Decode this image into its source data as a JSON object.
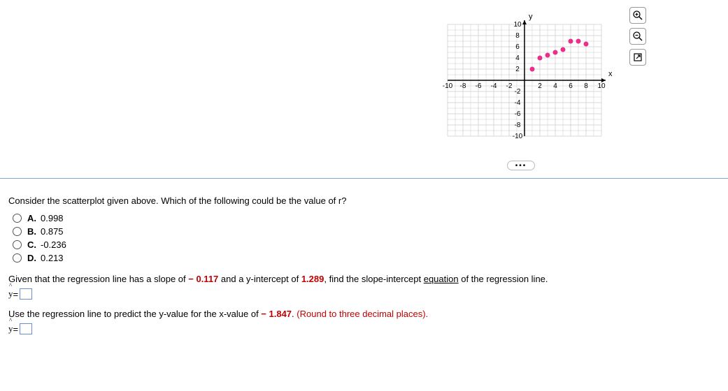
{
  "chart_data": {
    "type": "scatter",
    "x": [
      1,
      2,
      3,
      4,
      5,
      6,
      7,
      8
    ],
    "y": [
      2,
      4,
      4.5,
      5,
      5.5,
      7,
      7,
      6.5
    ],
    "xlabel": "x",
    "ylabel": "y",
    "xlim": [
      -10,
      10
    ],
    "ylim": [
      -10,
      10
    ],
    "xticks": [
      -10,
      -8,
      -6,
      -4,
      -2,
      2,
      4,
      6,
      8,
      10
    ],
    "yticks": [
      -10,
      -8,
      -6,
      -4,
      -2,
      2,
      4,
      6,
      8,
      10
    ]
  },
  "tools": {
    "zoom_in": "⊕",
    "zoom_out": "⊖",
    "open": "↗"
  },
  "more_label": "•••",
  "question": {
    "prompt": "Consider the scatterplot given above. Which of the following could be the value of r?",
    "options": [
      {
        "letter": "A.",
        "value": "0.998"
      },
      {
        "letter": "B.",
        "value": "0.875"
      },
      {
        "letter": "C.",
        "value": "-0.236"
      },
      {
        "letter": "D.",
        "value": "0.213"
      }
    ]
  },
  "statement1": {
    "pre": "Given that the regression line has a slope of ",
    "slope": "− 0.117",
    "mid": " and a y-intercept of ",
    "intercept": "1.289",
    "post1": ", find the slope-intercept ",
    "equation_word": "equation",
    "post2": " of the regression line."
  },
  "statement2": {
    "pre": "Use the regression line to predict the y-value for the x-value of ",
    "xval": "− 1.847",
    "post": ". ",
    "round": "(Round to three decimal places)."
  },
  "yhat_label_y": "y",
  "yhat_hat": "^",
  "equals": " = "
}
